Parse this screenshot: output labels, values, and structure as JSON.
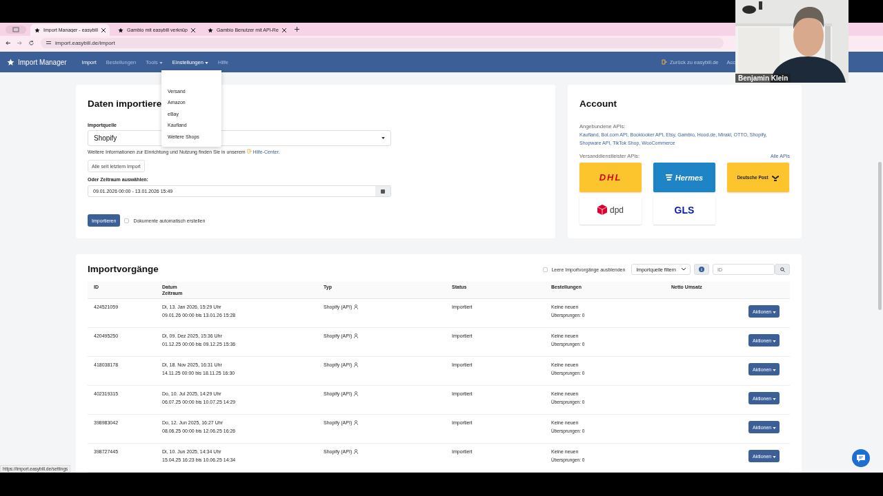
{
  "browser": {
    "tabs": [
      {
        "title": "Import Manager - easybill",
        "selected": true
      },
      {
        "title": "Gambio mit easybill verknüp",
        "selected": false
      },
      {
        "title": "Gambio Benutzer mit API-Re",
        "selected": false
      }
    ],
    "url": "import.easybill.de/import"
  },
  "navbar": {
    "brand": "Import Manager",
    "items": [
      {
        "label": "Import",
        "selected": true,
        "dropdown": false
      },
      {
        "label": "Bestellungen",
        "selected": false,
        "dropdown": false
      },
      {
        "label": "Tools",
        "selected": false,
        "dropdown": true
      },
      {
        "label": "Einstellungen",
        "selected": true,
        "dropdown": true
      },
      {
        "label": "Hilfe",
        "selected": false,
        "dropdown": false
      }
    ],
    "back_link": "Zurück zu easybill.de",
    "account_link": "Acc"
  },
  "dropdown_menu": {
    "items": [
      "Versand",
      "Amazon",
      "eBay",
      "Kaufland",
      "Weitere Shops"
    ]
  },
  "import_card": {
    "title": "Daten importiere",
    "source_label": "Importquelle",
    "source_value": "Shopify",
    "help_text": "Weitere Informationen zur Einrichtung und Nutzung finden Sie in unserem",
    "help_link": "Hilfe-Center.",
    "since_button": "Alle seit letztem Import",
    "range_label": "Oder Zeitraum auswählen:",
    "range_value": "09.01.2026 00:00 - 13.01.2026 15:49",
    "import_button": "Importieren",
    "auto_docs": {
      "label": "Dokumente automatisch erstellen",
      "checked": false
    }
  },
  "account_card": {
    "title": "Account",
    "apis_label": "Angebundene APIs:",
    "apis": "Kaufland, Bol.com API, Booklooker API, Etsy, Gambio, Hood.de, Mirakl, OTTO, Shopify, Shopware API, TikTok Shop, WooCommerce",
    "shipping_label": "Versanddienstleister APIs:",
    "all_apis_link": "Alle APIs",
    "carriers": [
      {
        "kind": "dhl",
        "name": "DHL"
      },
      {
        "kind": "hermes",
        "name": "Hermes"
      },
      {
        "kind": "post",
        "name": "Deutsche Post"
      },
      {
        "kind": "dpd",
        "name": "dpd"
      },
      {
        "kind": "gls",
        "name": "GLS"
      }
    ]
  },
  "imports": {
    "title": "Importvorgänge",
    "hide_empty": {
      "label": "Leere Importvorgänge ausblenden",
      "checked": false
    },
    "filter": "Importquelle filtern",
    "search": {
      "placeholder": "ID"
    },
    "columns": [
      "ID",
      "Datum",
      "Zeitraum",
      "Typ",
      "Status",
      "Bestellungen",
      "Netto Umsatz"
    ],
    "rows": [
      {
        "id": "424521059",
        "date": "Di, 13. Jan 2026, 15:29 Uhr",
        "range": "09.01.26 00:00 bis 13.01.26 15:28",
        "type": "Shopify (API)",
        "status": "Importiert",
        "orders": "Keine neuen",
        "skipped": "Übersprungen: 0",
        "action": "Aktionen"
      },
      {
        "id": "420495250",
        "date": "Di, 09. Dez 2025, 15:36 Uhr",
        "range": "01.12.25 00:00 bis 09.12.25 15:36",
        "type": "Shopify (API)",
        "status": "Importiert",
        "orders": "Keine neuen",
        "skipped": "Übersprungen: 0",
        "action": "Aktionen"
      },
      {
        "id": "418038178",
        "date": "Di, 18. Nov 2025, 16:31 Uhr",
        "range": "14.11.25 00:00 bis 18.11.25 16:30",
        "type": "Shopify (API)",
        "status": "Importiert",
        "orders": "Keine neuen",
        "skipped": "Übersprungen: 0",
        "action": "Aktionen"
      },
      {
        "id": "402319315",
        "date": "Do, 10. Jul 2025, 14:29 Uhr",
        "range": "06.07.25 00:00 bis 10.07.25 14:29",
        "type": "Shopify (API)",
        "status": "Importiert",
        "orders": "Keine neuen",
        "skipped": "Übersprungen: 0",
        "action": "Aktionen"
      },
      {
        "id": "398983042",
        "date": "Do, 12. Jun 2025, 16:27 Uhr",
        "range": "08.06.25 00:00 bis 12.06.25 16:26",
        "type": "Shopify (API)",
        "status": "Importiert",
        "orders": "Keine neuen",
        "skipped": "Übersprungen: 0",
        "action": "Aktionen"
      },
      {
        "id": "398727445",
        "date": "Di, 10. Jun 2025, 14:34 Uhr",
        "range": "15.04.25 16:23 bis 10.06.25 14:34",
        "type": "Shopify (API)",
        "status": "Importiert",
        "orders": "Keine neuen",
        "skipped": "Übersprungen: 0",
        "action": "Aktionen"
      }
    ]
  },
  "status_url": "https://import.easybill.de/settings",
  "webcam": {
    "name": "Benjamin Klein"
  }
}
